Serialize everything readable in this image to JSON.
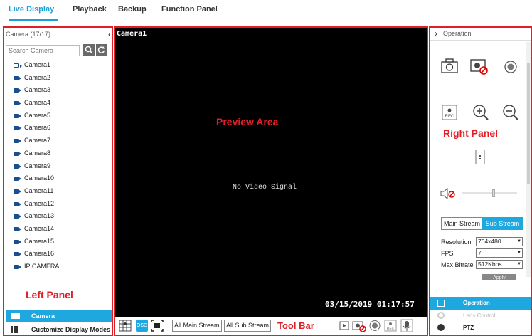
{
  "nav": {
    "tabs": [
      "Live Display",
      "Playback",
      "Backup",
      "Function Panel"
    ],
    "active_index": 0
  },
  "left_panel": {
    "header": "Camera (17/17)",
    "search_placeholder": "Search Camera",
    "cameras": [
      "Camera1",
      "Camera2",
      "Camera3",
      "Camera4",
      "Camera5",
      "Camera6",
      "Camera7",
      "Camera8",
      "Camera9",
      "Camera10",
      "Camera11",
      "Camera12",
      "Camera13",
      "Camera14",
      "Camera15",
      "Camera16",
      "IP CAMERA"
    ],
    "annotation": "Left Panel",
    "footer": [
      "Camera",
      "Customize Display Modes"
    ]
  },
  "preview": {
    "camera_name": "Camera1",
    "annotation": "Preview Area",
    "status": "No Video Signal",
    "timestamp": "03/15/2019 01:17:57"
  },
  "toolbar": {
    "osd": "OSD",
    "all_main": "All Main Stream",
    "all_sub": "All Sub Stream",
    "annotation": "Tool Bar"
  },
  "right_panel": {
    "header": "Operation",
    "annotation": "Right Panel",
    "stream_tabs": [
      "Main Stream",
      "Sub Stream"
    ],
    "active_stream": 1,
    "fields": [
      {
        "label": "Resolution",
        "value": "704x480"
      },
      {
        "label": "FPS",
        "value": "7"
      },
      {
        "label": "Max Bitrate",
        "value": "512Kbps"
      }
    ],
    "apply": "Apply",
    "footer": [
      "Operation",
      "Lens Control",
      "PTZ"
    ]
  },
  "colors": {
    "accent": "#1fa7e0",
    "annotation": "#e01e26"
  }
}
